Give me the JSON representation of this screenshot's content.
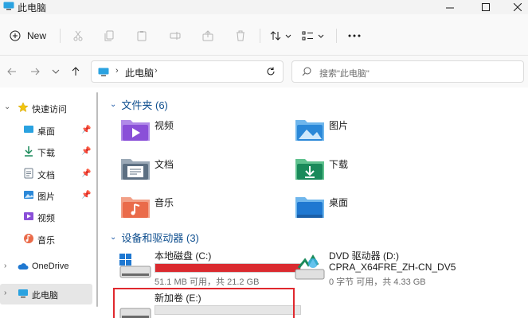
{
  "window": {
    "title": "此电脑"
  },
  "toolbar": {
    "new_label": "New"
  },
  "address": {
    "crumb": "此电脑"
  },
  "search": {
    "placeholder": "搜索\"此电脑\""
  },
  "sidebar": {
    "items": [
      {
        "label": "快速访问",
        "icon": "star-icon"
      },
      {
        "label": "桌面",
        "icon": "desktop-icon"
      },
      {
        "label": "下载",
        "icon": "download-icon"
      },
      {
        "label": "文档",
        "icon": "document-icon"
      },
      {
        "label": "图片",
        "icon": "picture-icon"
      },
      {
        "label": "视频",
        "icon": "video-icon"
      },
      {
        "label": "音乐",
        "icon": "music-icon"
      },
      {
        "label": "OneDrive",
        "icon": "cloud-icon"
      },
      {
        "label": "此电脑",
        "icon": "pc-icon"
      }
    ]
  },
  "folders_section": {
    "title": "文件夹 (6)"
  },
  "folders": [
    {
      "name": "视频",
      "icon": "video-folder-icon"
    },
    {
      "name": "图片",
      "icon": "picture-folder-icon"
    },
    {
      "name": "文档",
      "icon": "document-folder-icon"
    },
    {
      "name": "下载",
      "icon": "download-folder-icon"
    },
    {
      "name": "音乐",
      "icon": "music-folder-icon"
    },
    {
      "name": "桌面",
      "icon": "desktop-folder-icon"
    }
  ],
  "devices_section": {
    "title": "设备和驱动器 (3)"
  },
  "drives": [
    {
      "name": "本地磁盘 (C:)",
      "info": "51.1 MB 可用，共 21.2 GB",
      "used_fraction": 0.998,
      "bar_color": "#da2a2f"
    },
    {
      "name": "DVD 驱动器 (D:)",
      "name2": "CPRA_X64FRE_ZH-CN_DV5",
      "info": "0 字节 可用，共 4.33 GB"
    },
    {
      "name": "新加卷 (E:)",
      "used_fraction": 0.0,
      "bar_color": "#26a0da"
    }
  ],
  "colors": {
    "accent": "#0f4f8f",
    "selected": "#e6e6e6",
    "danger": "#da2a2f"
  }
}
